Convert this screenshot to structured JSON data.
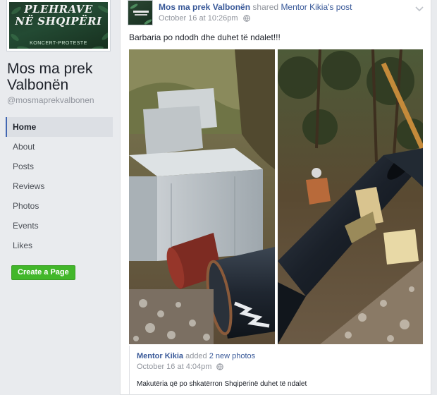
{
  "sidebar": {
    "cover": {
      "title_line1": "PLEHRAVE",
      "title_line2": "NË SHQIPËRI",
      "subtitle": "KONCERT-PROTESTE"
    },
    "page_name": "Mos ma prek Valbonën",
    "handle": "@mosmaprekvalbonen",
    "nav_items": [
      {
        "label": "Home",
        "active": true
      },
      {
        "label": "About"
      },
      {
        "label": "Posts"
      },
      {
        "label": "Reviews"
      },
      {
        "label": "Photos"
      },
      {
        "label": "Events"
      },
      {
        "label": "Likes"
      }
    ],
    "create_page_label": "Create a Page"
  },
  "post": {
    "author": "Mos ma prek Valbonën",
    "shared_word": "shared",
    "shared_from": "Mentor Kikia",
    "shared_suffix": "'s post",
    "timestamp": "October 16 at 10:26pm",
    "text": "Barbaria po ndodh dhe duhet të ndalet!!!",
    "photos": [
      {
        "icon": "concrete-pipe-photo"
      },
      {
        "icon": "pipeline-forest-photo"
      }
    ],
    "shared_post": {
      "author": "Mentor Kikia",
      "action": "added",
      "photos_link": "2 new photos",
      "timestamp": "October 16 at 4:04pm",
      "text": "Makutëria që po shkatërron Shqipërinë duhet të ndalet"
    }
  },
  "colors": {
    "link": "#385898",
    "green_button": "#42b72a",
    "nav_active_bar": "#4267b2",
    "background": "#e9ebee"
  }
}
